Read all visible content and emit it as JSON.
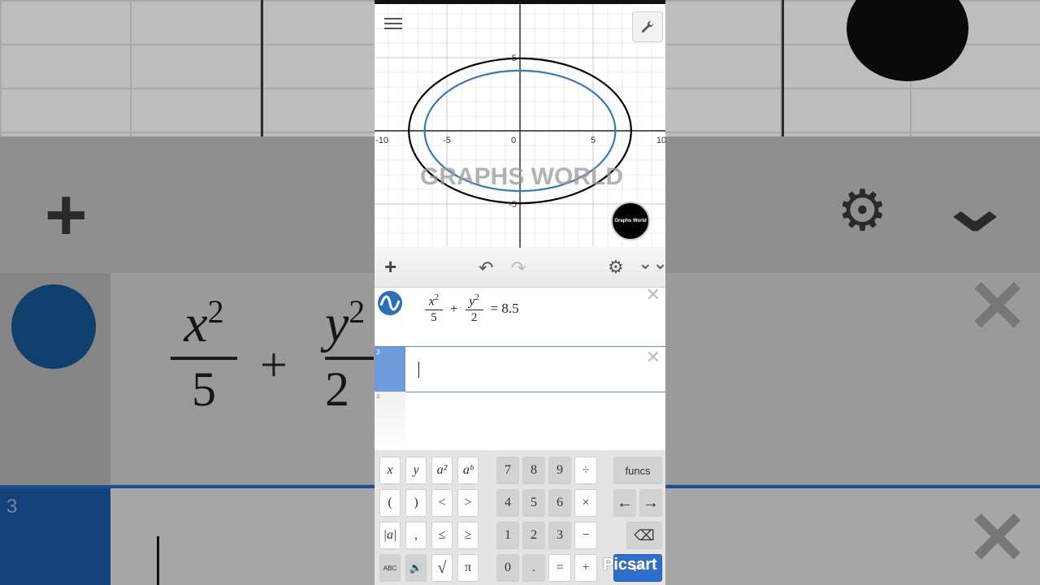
{
  "background": {
    "big_fraction1": {
      "num": "x",
      "exp": "2",
      "den": "5"
    },
    "big_plus": "+",
    "big_fraction2": {
      "num": "y",
      "exp": "2",
      "den": "2"
    },
    "row_number": "3"
  },
  "graph": {
    "x_ticks": [
      "-10",
      "-5",
      "0",
      "5",
      "10"
    ],
    "y_ticks": [
      "5",
      "-5"
    ],
    "watermark": "GRAPHS WORLD",
    "badge_text": "Graphs World",
    "curves": [
      {
        "equation": "x^2/5 + y^2/2 = 8.5",
        "a": 6.52,
        "b": 4.12,
        "color": "#3a7ab4"
      },
      {
        "equation": "outer ellipse",
        "a": 7.6,
        "b": 4.95,
        "color": "#000000"
      }
    ],
    "x_range": [
      -10,
      10
    ],
    "y_range": [
      -8.2,
      8.2
    ]
  },
  "toolbar": {
    "add": "+",
    "undo": "↶",
    "redo": "↷",
    "settings": "⚙",
    "collapse": "⌄⌄"
  },
  "expressions": [
    {
      "number": "",
      "frac1_num": "x",
      "frac1_exp": "2",
      "frac1_den": "5",
      "op": "+",
      "frac2_num": "y",
      "frac2_exp": "2",
      "frac2_den": "2",
      "eq": "= 8.5"
    },
    {
      "number": "3"
    },
    {
      "number": "4"
    }
  ],
  "keypad": {
    "row1": [
      "x",
      "y",
      "a²",
      "aᵇ",
      "7",
      "8",
      "9",
      "÷",
      "funcs"
    ],
    "row2": [
      "(",
      ")",
      "<",
      ">",
      "4",
      "5",
      "6",
      "×",
      "←",
      "→"
    ],
    "row3": [
      "|a|",
      ",",
      "≤",
      "≥",
      "1",
      "2",
      "3",
      "−",
      "⌫"
    ],
    "row4": [
      "ABC",
      "🔊",
      "√",
      "π",
      "0",
      ".",
      "=",
      "+",
      "↵"
    ]
  },
  "overlay_brand": "Picsart"
}
